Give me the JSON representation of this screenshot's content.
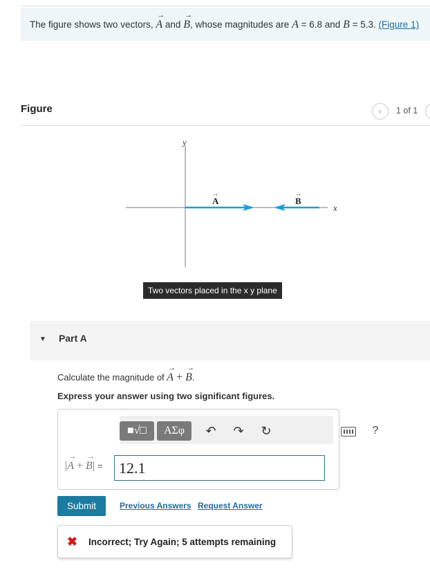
{
  "problem": {
    "intro": "The figure shows two vectors,",
    "vec_a": "A",
    "and1": "and",
    "vec_b": "B",
    "mag_text": ", whose magnitudes are",
    "a_sym": "A",
    "a_value": "= 6.8 and",
    "b_sym": "B",
    "b_value": "= 5.3.",
    "figure_link": "(Figure 1)"
  },
  "figure": {
    "title": "Figure",
    "pager_label": "1 of 1",
    "axis_y_label": "y",
    "axis_x_label": "x",
    "vector_a_label": "A",
    "vector_b_label": "B",
    "caption": "Two vectors placed in the x y plane",
    "vector_color": "#1a9fd4"
  },
  "part": {
    "title": "Part A",
    "question_prefix": "Calculate the magnitude of",
    "q_a": "A",
    "q_plus": " + ",
    "q_b": "B",
    "q_period": ".",
    "instruction": "Express your answer using two significant figures."
  },
  "toolbar": {
    "template_label": "■√□",
    "greek_label": "ΑΣφ",
    "undo_icon": "undo-icon",
    "redo_icon": "redo-icon",
    "reset_icon": "reset-icon",
    "keyboard_icon": "keyboard-icon",
    "help_label": "?"
  },
  "answer": {
    "expr_a": "A",
    "expr_plus": " + ",
    "expr_b": "B",
    "expr_bar": "|",
    "expr_eq": "=",
    "value": "12.1"
  },
  "actions": {
    "submit": "Submit",
    "previous_answers": "Previous Answers",
    "request_answer": "Request Answer"
  },
  "feedback": {
    "icon": "✖",
    "message": "Incorrect; Try Again; 5 attempts remaining"
  },
  "colors": {
    "accent": "#1d7aa0",
    "link": "#1c6ea4",
    "error": "#d0191c"
  }
}
